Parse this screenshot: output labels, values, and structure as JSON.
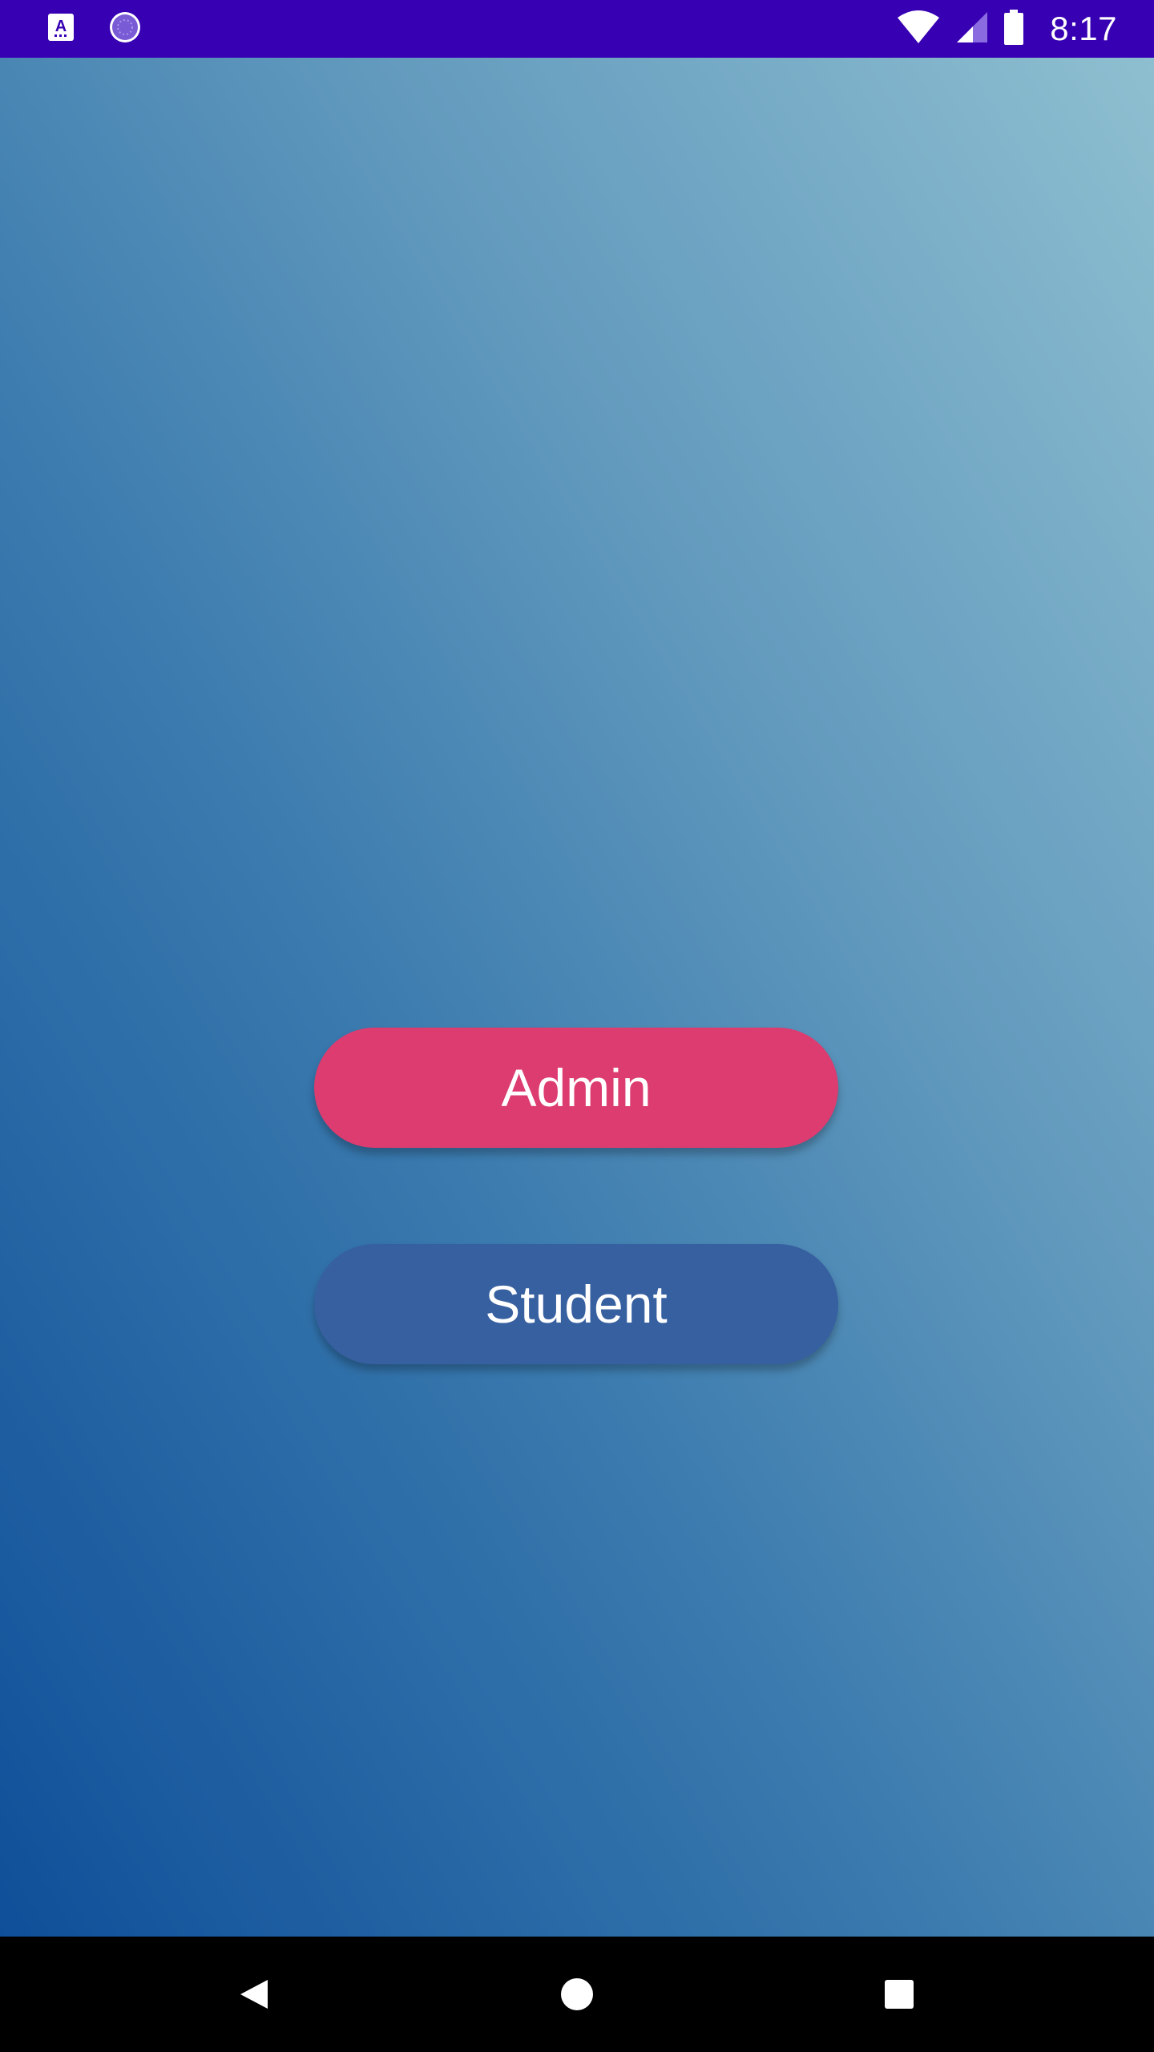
{
  "status_bar": {
    "time": "8:17",
    "left_icons": [
      "app-a-icon",
      "loading-spinner-icon"
    ],
    "right_icons": [
      "wifi-icon",
      "cellular-signal-icon",
      "battery-icon"
    ],
    "background": "#3700b3"
  },
  "main": {
    "buttons": [
      {
        "label": "Admin",
        "color": "#dc3c70"
      },
      {
        "label": "Student",
        "color": "#3760a0"
      }
    ]
  },
  "nav_bar": {
    "icons": [
      "back-icon",
      "home-icon",
      "recents-icon"
    ]
  }
}
